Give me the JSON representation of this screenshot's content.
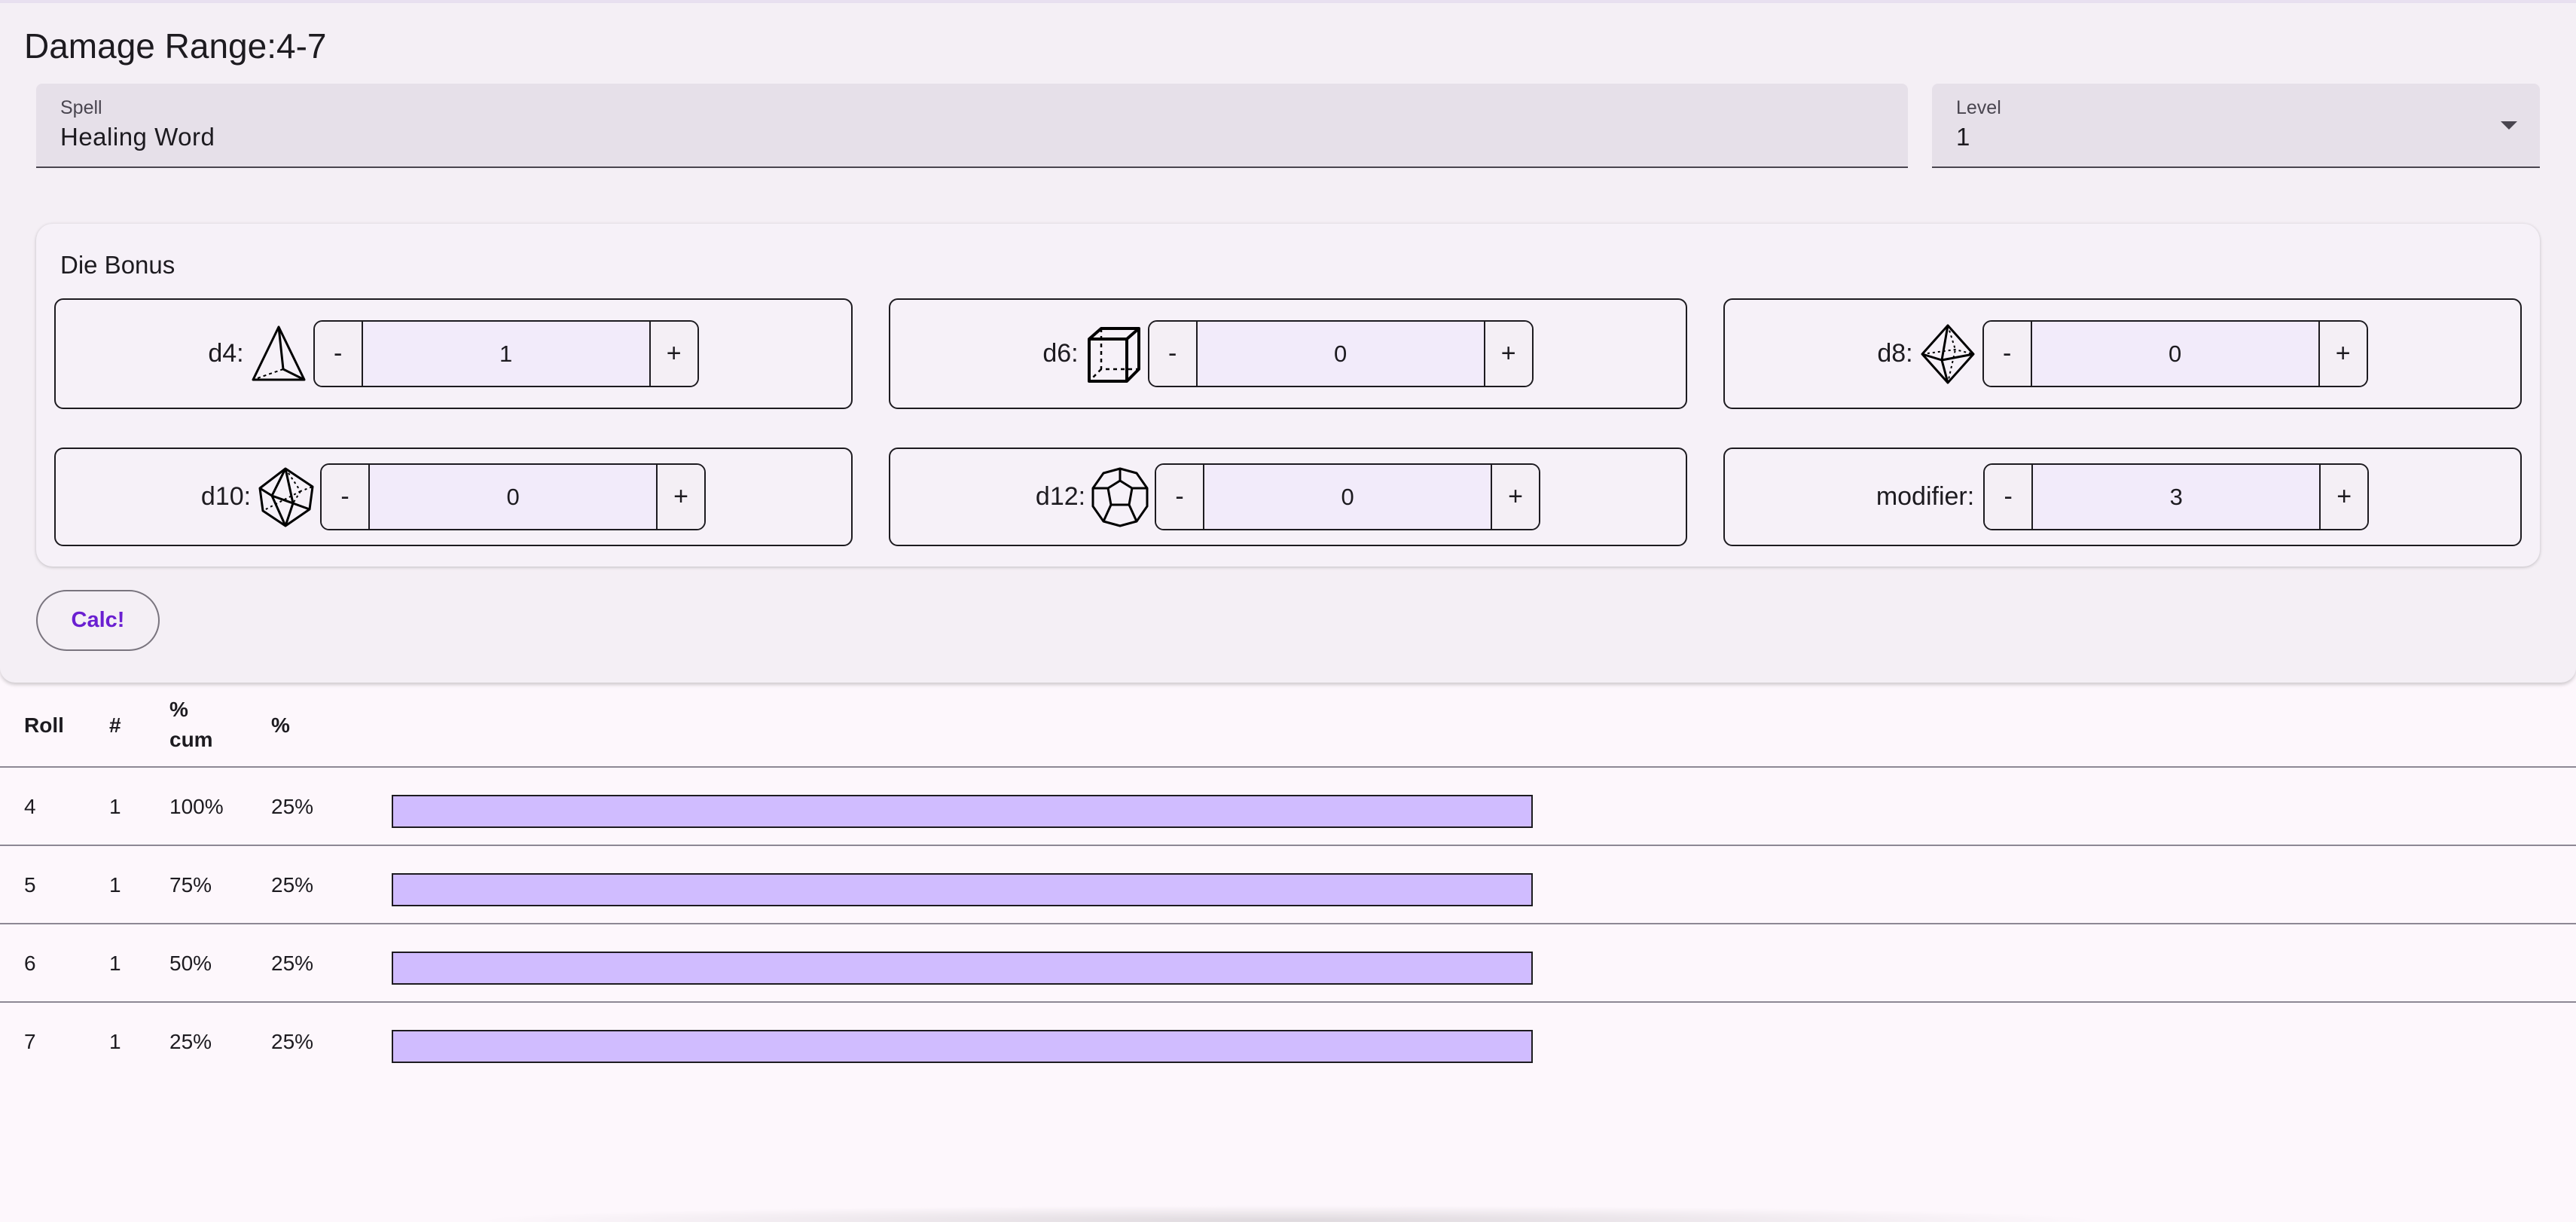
{
  "header": {
    "title": "Damage Range:4-7"
  },
  "spell": {
    "label": "Spell",
    "value": "Healing Word"
  },
  "level": {
    "label": "Level",
    "value": "1"
  },
  "bonus": {
    "title": "Die Bonus",
    "dice": [
      {
        "label": "d4:",
        "icon": "d4-tetrahedron-icon",
        "value": "1"
      },
      {
        "label": "d6:",
        "icon": "d6-cube-icon",
        "value": "0"
      },
      {
        "label": "d8:",
        "icon": "d8-octahedron-icon",
        "value": "0"
      },
      {
        "label": "d10:",
        "icon": "d10-pentagonal-trapezohedron-icon",
        "value": "0"
      },
      {
        "label": "d12:",
        "icon": "d12-dodecahedron-icon",
        "value": "0"
      },
      {
        "label": "modifier:",
        "icon": "",
        "value": "3"
      }
    ],
    "minus": "-",
    "plus": "+"
  },
  "calc": {
    "label": "Calc!"
  },
  "results": {
    "headers": {
      "roll": "Roll",
      "count": "#",
      "cum_line1": "%",
      "cum_line2": "cum",
      "pct": "%"
    },
    "rows": [
      {
        "roll": "4",
        "count": "1",
        "cum": "100%",
        "pct": "25%",
        "fraction": 1.0
      },
      {
        "roll": "5",
        "count": "1",
        "cum": "75%",
        "pct": "25%",
        "fraction": 1.0
      },
      {
        "roll": "6",
        "count": "1",
        "cum": "50%",
        "pct": "25%",
        "fraction": 1.0
      },
      {
        "roll": "7",
        "count": "1",
        "cum": "25%",
        "pct": "25%",
        "fraction": 1.0
      }
    ]
  },
  "colors": {
    "bar": "#d0bcff",
    "accent": "#6a1fd1"
  }
}
